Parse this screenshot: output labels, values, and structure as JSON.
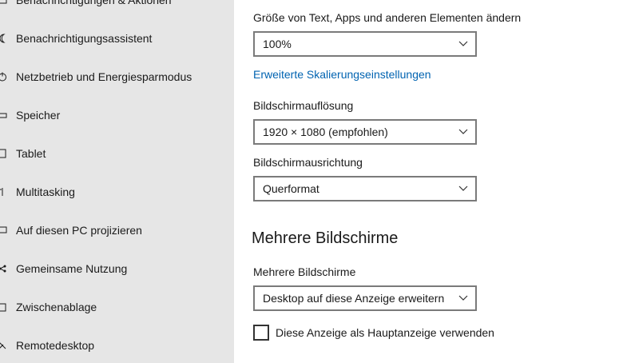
{
  "sidebar": {
    "items": [
      {
        "label": "Benachrichtigungen & Aktionen",
        "icon": "notifications-icon"
      },
      {
        "label": "Benachrichtigungsassistent",
        "icon": "moon-icon"
      },
      {
        "label": "Netzbetrieb und Energiesparmodus",
        "icon": "power-icon"
      },
      {
        "label": "Speicher",
        "icon": "storage-icon"
      },
      {
        "label": "Tablet",
        "icon": "tablet-icon"
      },
      {
        "label": "Multitasking",
        "icon": "multitasking-icon"
      },
      {
        "label": "Auf diesen PC projizieren",
        "icon": "project-icon"
      },
      {
        "label": "Gemeinsame Nutzung",
        "icon": "share-icon"
      },
      {
        "label": "Zwischenablage",
        "icon": "clipboard-icon"
      },
      {
        "label": "Remotedesktop",
        "icon": "remote-desktop-icon"
      }
    ]
  },
  "main": {
    "scale": {
      "label": "Größe von Text, Apps und anderen Elementen ändern",
      "value": "100%"
    },
    "advanced_scaling_link": "Erweiterte Skalierungseinstellungen",
    "resolution": {
      "label": "Bildschirmauflösung",
      "value": "1920 × 1080 (empfohlen)"
    },
    "orientation": {
      "label": "Bildschirmausrichtung",
      "value": "Querformat"
    },
    "multiple_displays_heading": "Mehrere Bildschirme",
    "multiple_displays": {
      "label": "Mehrere Bildschirme",
      "value": "Desktop auf diese Anzeige erweitern"
    },
    "main_display_checkbox": {
      "label": "Diese Anzeige als Hauptanzeige verwenden",
      "checked": false
    }
  },
  "colors": {
    "sidebar_bg": "#e6e6e6",
    "link": "#0063b1",
    "dropdown_border": "#7a7a7a"
  }
}
